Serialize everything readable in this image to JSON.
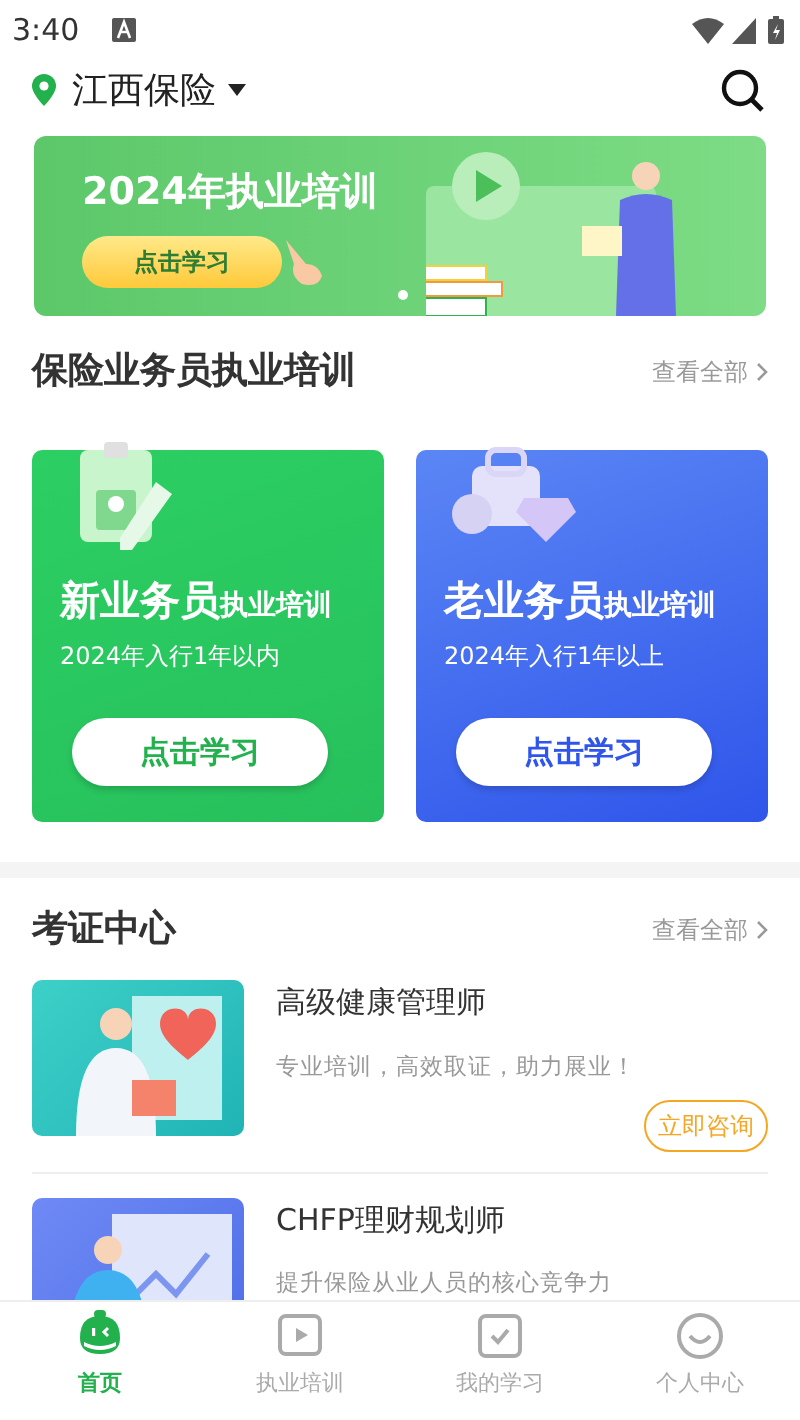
{
  "status_bar": {
    "time": "3:40"
  },
  "header": {
    "location": "江西保险"
  },
  "banner": {
    "title": "2024年执业培训",
    "button": "点击学习"
  },
  "training": {
    "title": "保险业务员执业培训",
    "more": "查看全部",
    "cards": [
      {
        "kind": "new",
        "title": "新业务员",
        "suffix": "执业培训",
        "subtitle": "2024年入行1年以内",
        "button": "点击学习"
      },
      {
        "kind": "old",
        "title": "老业务员",
        "suffix": "执业培训",
        "subtitle": "2024年入行1年以上",
        "button": "点击学习"
      }
    ]
  },
  "certificates": {
    "title": "考证中心",
    "more": "查看全部",
    "items": [
      {
        "kind": "health",
        "title": "高级健康管理师",
        "desc": "专业培训，高效取证，助力展业！",
        "button": "立即咨询"
      },
      {
        "kind": "finance",
        "title": "CHFP理财规划师",
        "desc": "提升保险从业人员的核心竞争力"
      }
    ]
  },
  "tab_bar": [
    {
      "kind": "home",
      "label": "首页",
      "selected": true
    },
    {
      "kind": "video",
      "label": "执业培训",
      "selected": false
    },
    {
      "kind": "check",
      "label": "我的学习",
      "selected": false
    },
    {
      "kind": "smile",
      "label": "个人中心",
      "selected": false
    }
  ]
}
